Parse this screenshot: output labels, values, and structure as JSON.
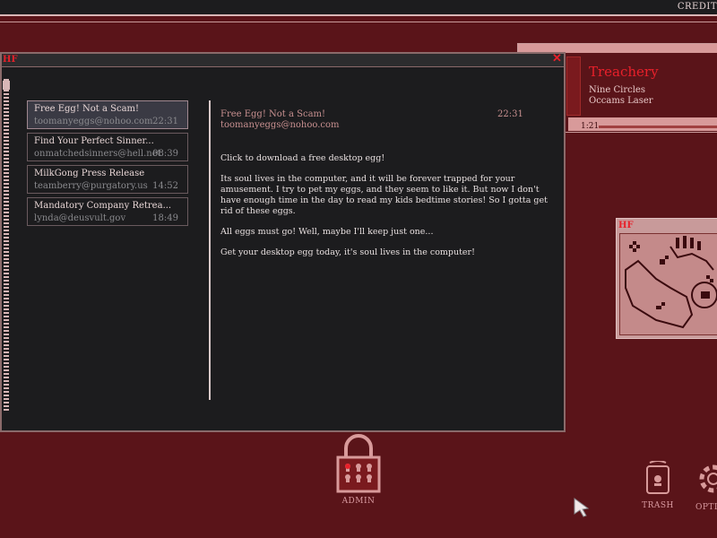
{
  "topbar": {
    "credits": "CREDIT"
  },
  "music": {
    "song": "Treachery",
    "artist": "Nine Circles",
    "album": "Occams Laser",
    "time": "1:21",
    "progress_fraction": 0.0
  },
  "window": {
    "logo": "HF",
    "close": "✕"
  },
  "image_window": {
    "logo": "HF"
  },
  "mail": {
    "items": [
      {
        "subject": "Free Egg!  Not a Scam!",
        "from": "toomanyeggs@nohoo.com",
        "time": "22:31"
      },
      {
        "subject": "Find Your Perfect Sinner...",
        "from": "onmatchedsinners@hell.net",
        "time": "08:39"
      },
      {
        "subject": "MilkGong Press Release",
        "from": "teamberry@purgatory.us",
        "time": "14:52"
      },
      {
        "subject": "Mandatory Company Retrea...",
        "from": "lynda@deusvult.gov",
        "time": "18:49"
      }
    ],
    "open": {
      "subject": "Free Egg!  Not a Scam!",
      "from": "toomanyeggs@nohoo.com",
      "time": "22:31",
      "body": [
        "Click to download a free desktop egg!",
        "Its soul lives in the computer, and it will be forever trapped for your amusement.  I try to pet my eggs, and they seem to like it.  But now I don't have enough time in the day to read my kids bedtime stories!  So I gotta get rid of these eggs.",
        "All eggs must go!  Well, maybe I'll keep just one...",
        "Get your desktop egg today, it's soul lives in the computer!"
      ]
    }
  },
  "desktop": {
    "admin_label": "ADMIN",
    "trash_label": "TRASH",
    "options_label": "OPTI"
  },
  "colors": {
    "background": "#5a1419",
    "window": "#1c1c1e",
    "accent_red": "#e8202a",
    "pink": "#d89a9a"
  }
}
